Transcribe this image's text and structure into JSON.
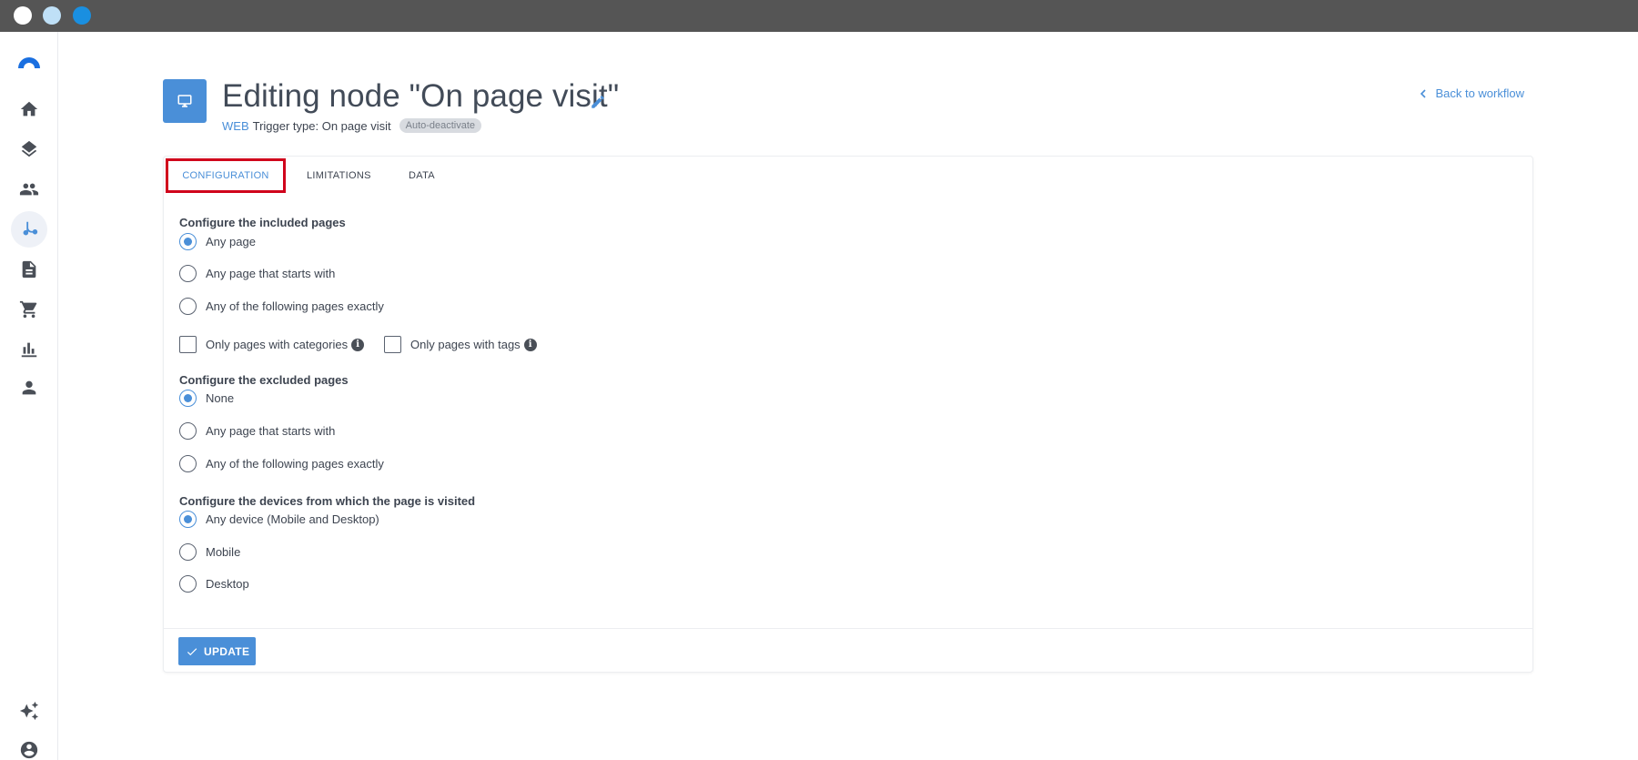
{
  "header": {
    "title": "Editing node \"On page visit\"",
    "channel": "WEB",
    "trigger_type": "Trigger type: On page visit",
    "badge": "Auto-deactivate",
    "back_link": "Back to workflow"
  },
  "tabs": [
    {
      "label": "CONFIGURATION",
      "active": true
    },
    {
      "label": "LIMITATIONS",
      "active": false
    },
    {
      "label": "DATA",
      "active": false
    }
  ],
  "included": {
    "title": "Configure the included pages",
    "options": [
      {
        "label": "Any page",
        "checked": true
      },
      {
        "label": "Any page that starts with",
        "checked": false
      },
      {
        "label": "Any of the following pages exactly",
        "checked": false
      }
    ],
    "checkboxes": [
      {
        "label": "Only pages with categories",
        "checked": false
      },
      {
        "label": "Only pages with tags",
        "checked": false
      }
    ]
  },
  "excluded": {
    "title": "Configure the excluded pages",
    "options": [
      {
        "label": "None",
        "checked": true
      },
      {
        "label": "Any page that starts with",
        "checked": false
      },
      {
        "label": "Any of the following pages exactly",
        "checked": false
      }
    ]
  },
  "devices": {
    "title": "Configure the devices from which the page is visited",
    "options": [
      {
        "label": "Any device (Mobile and Desktop)",
        "checked": true
      },
      {
        "label": "Mobile",
        "checked": false
      },
      {
        "label": "Desktop",
        "checked": false
      }
    ]
  },
  "footer": {
    "update_label": "UPDATE"
  },
  "sidebar": {
    "icons": [
      "home-icon",
      "layers-icon",
      "people-icon",
      "workflow-icon",
      "document-icon",
      "cart-icon",
      "chart-icon",
      "person-icon",
      "sparkle-icon",
      "account-circle-icon"
    ]
  },
  "colors": {
    "accent": "#4a8fd8",
    "highlight": "#d0021b",
    "titlebar": "#555555"
  }
}
